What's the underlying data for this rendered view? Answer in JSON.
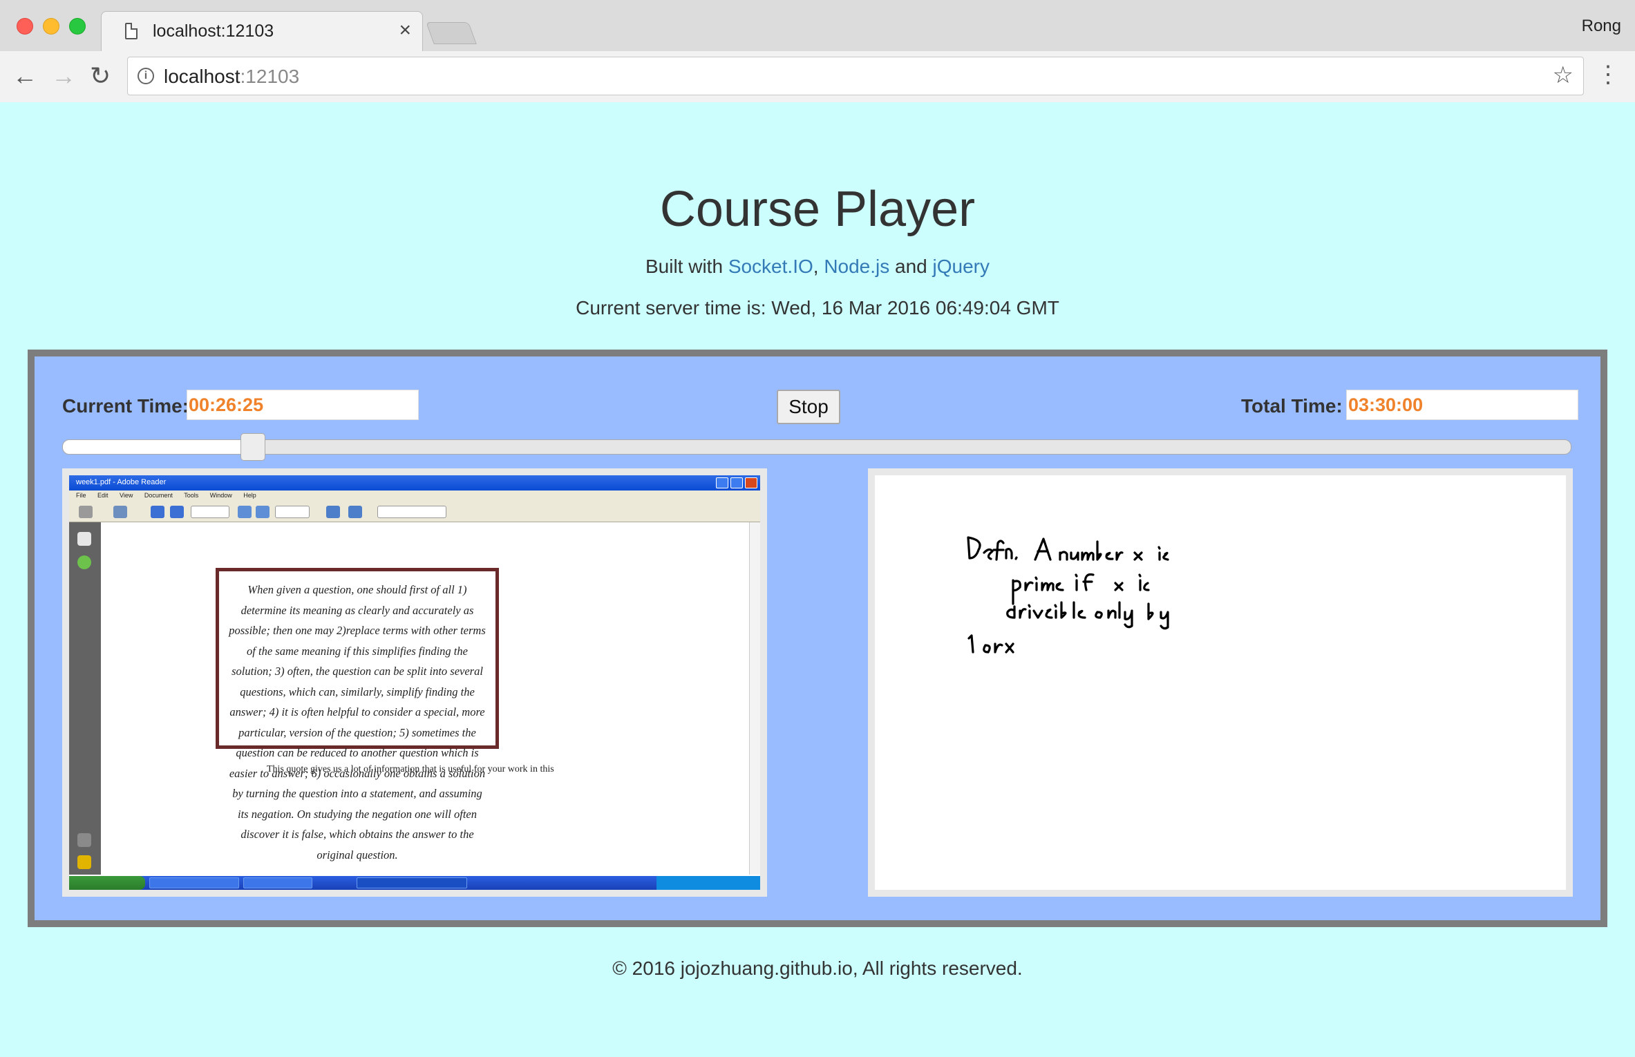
{
  "browser": {
    "tab_title": "localhost:12103",
    "tab_close": "×",
    "profile_name": "Rong",
    "url_host": "localhost",
    "url_port": ":12103",
    "back": "←",
    "forward": "→",
    "reload": "↻",
    "info": "i",
    "star": "☆",
    "menu": "⋮"
  },
  "page": {
    "title": "Course Player",
    "built_prefix": "Built with ",
    "built_links": [
      "Socket.IO",
      "Node.js",
      "jQuery"
    ],
    "built_sep1": ", ",
    "built_sep2": " and ",
    "server_time": "Current server time is: Wed, 16 Mar 2016 06:49:04 GMT",
    "footer": "© 2016 jojozhuang.github.io, All rights reserved."
  },
  "player": {
    "current_label": "Current Time:",
    "current_value": "00:26:25",
    "total_label": "Total Time:",
    "total_value": "03:30:00",
    "stop_label": "Stop",
    "progress": 0.126
  },
  "screenshot": {
    "window_title": "week1.pdf - Adobe Reader",
    "menu": "File Edit View Document Tools Window Help",
    "quote": "When given a question, one should first of all 1) determine its meaning as clearly and accurately as possible; then one may 2)replace terms with other terms of the same meaning if this simplifies finding the solution; 3) often, the question can be split into several questions, which can, similarly, simplify finding the answer; 4) it is often helpful to consider a special, more particular, version of the question; 5) sometimes the question can be reduced to another question which is easier to answer; 6) occasionally one obtains a solution by turning the question into a statement, and assuming its negation. On studying the negation one will often discover it is false, which obtains the answer to the original question.",
    "after_quote": "This quote gives us a lot of information that is useful for your work in this"
  },
  "whiteboard": {
    "lines": [
      "Defn.  A number x is",
      "prime  if  x  is",
      "divisible  only  by",
      "1  or  x"
    ]
  },
  "colors": {
    "page_bg": "#cbfefc",
    "player_bg": "#99bbff",
    "player_border": "#7d7d7d",
    "time_value": "#f0822b",
    "link": "#337ab7"
  }
}
